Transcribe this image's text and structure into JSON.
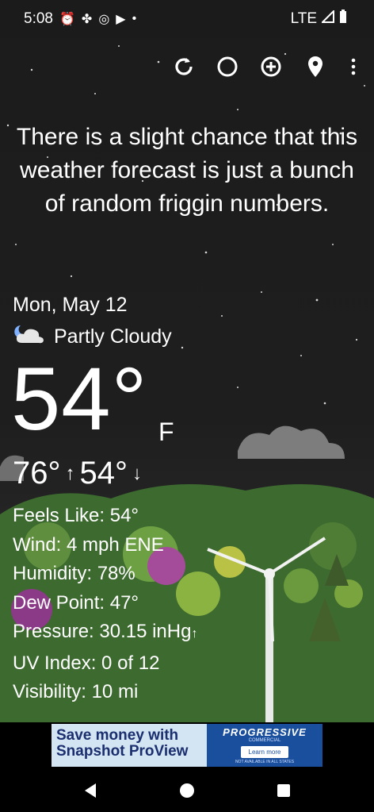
{
  "status": {
    "time": "5:08",
    "network": "LTE"
  },
  "quote": "There is a slight chance that this weather forecast is just a bunch of random friggin numbers.",
  "current": {
    "date": "Mon, May 12",
    "condition": "Partly Cloudy",
    "temperature": "54°",
    "unit": "F",
    "high": "76°",
    "low": "54°"
  },
  "details": {
    "feels_like": "Feels Like:  54°",
    "wind": "Wind:  4 mph ENE",
    "humidity": "Humidity:  78%",
    "dew_point": "Dew Point:  47°",
    "pressure": "Pressure:  30.15 inHg",
    "uv_index": "UV Index:  0 of 12",
    "visibility": "Visibility:  10 mi"
  },
  "ad": {
    "headline_line1": "Save money with",
    "headline_line2": "Snapshot ProView",
    "brand": "PROGRESSIVE",
    "brand_sub": "COMMERCIAL",
    "cta": "Learn more",
    "fine_print": "NOT AVAILABLE IN ALL STATES"
  },
  "colors": {
    "sky": "#1c1c1c",
    "grass": "#3a6b2e",
    "text": "#ffffff"
  }
}
